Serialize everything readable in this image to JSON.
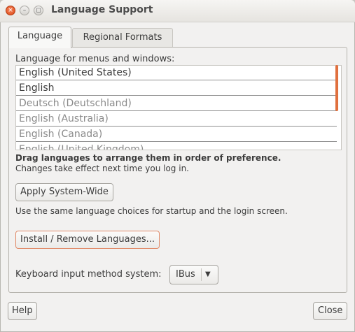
{
  "window": {
    "title": "Language Support",
    "close_glyph": "×",
    "minimize_glyph": "–",
    "maximize_glyph": "◻"
  },
  "tabs": [
    {
      "label": "Language"
    },
    {
      "label": "Regional Formats"
    }
  ],
  "language_tab": {
    "list_label": "Language for menus and windows:",
    "languages": [
      "English (United States)",
      "English",
      "Deutsch (Deutschland)",
      "English (Australia)",
      "English (Canada)",
      "English (United Kingdom)"
    ],
    "drag_hint": "Drag languages to arrange them in order of preference.",
    "effect_note": "Changes take effect next time you log in.",
    "apply_button": "Apply System-Wide",
    "apply_note": "Use the same language choices for startup and the login screen.",
    "install_button": "Install / Remove Languages...",
    "keyboard_label": "Keyboard input method system:",
    "keyboard_value": "IBus",
    "dropdown_glyph": "▼"
  },
  "footer": {
    "help_button": "Help",
    "close_button": "Close"
  },
  "colors": {
    "accent": "#e0703e",
    "close_button": "#dd4814"
  }
}
